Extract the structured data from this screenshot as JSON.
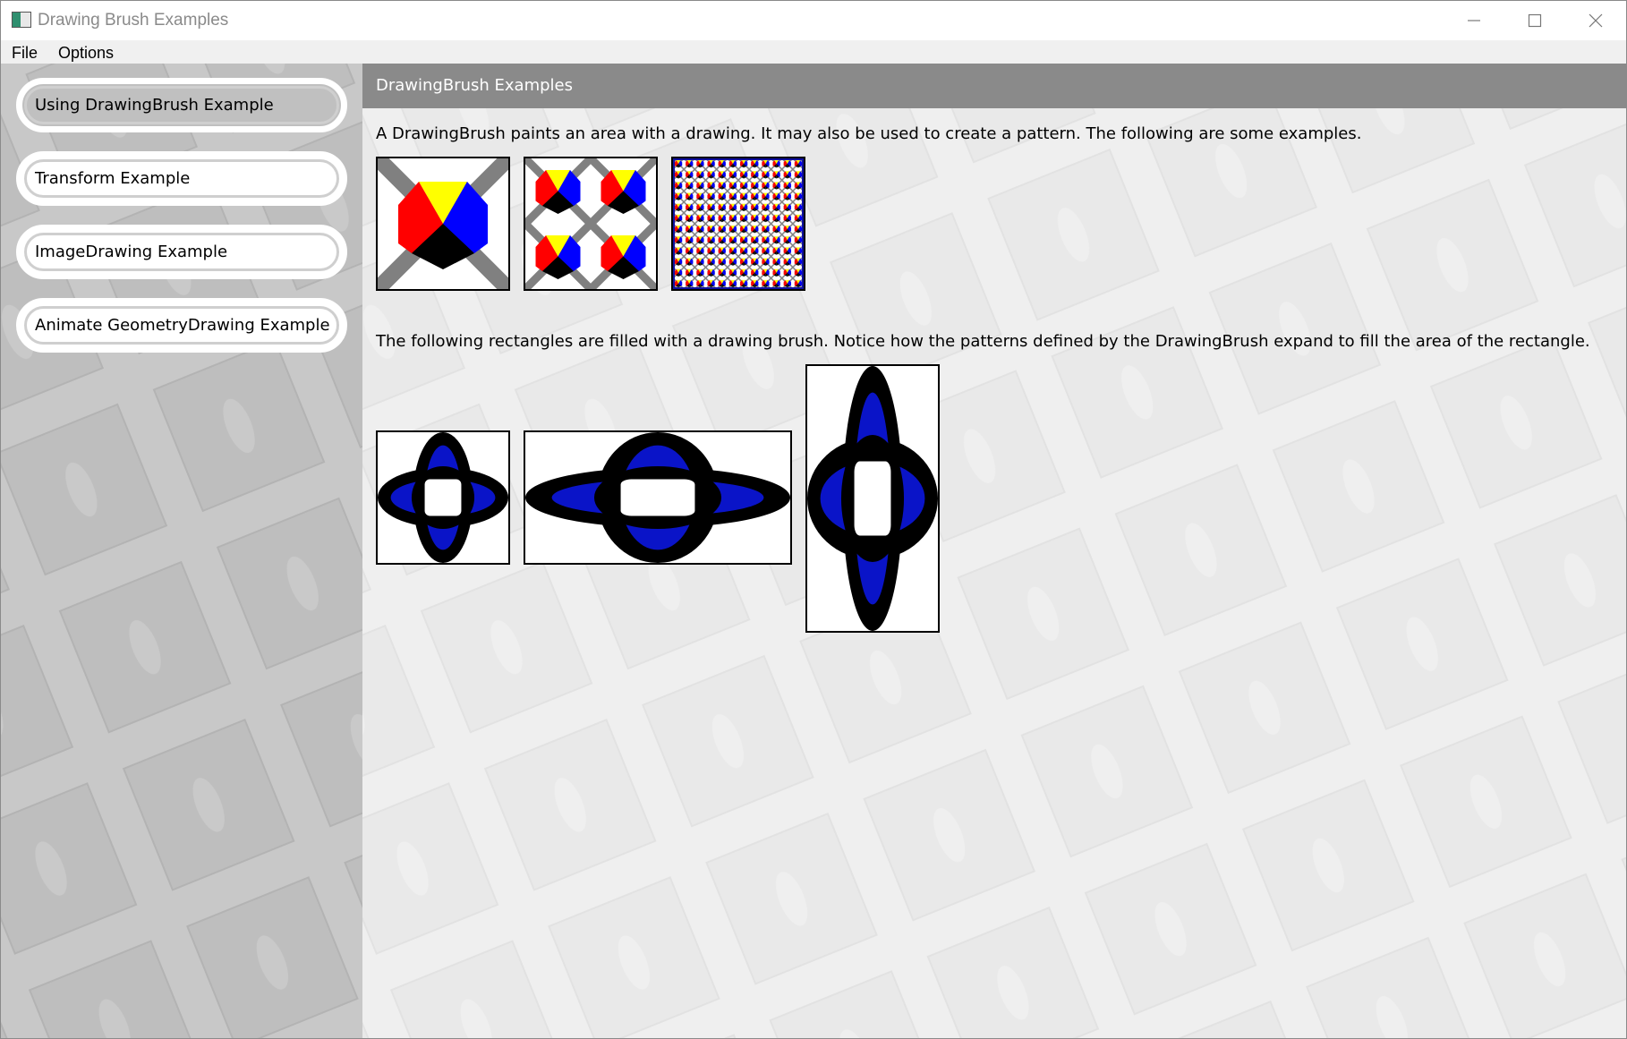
{
  "window": {
    "title": "Drawing Brush Examples",
    "icon": "app-window-icon",
    "controls": [
      "minimize-icon",
      "maximize-icon",
      "close-icon"
    ]
  },
  "menu": {
    "items": [
      "File",
      "Options"
    ]
  },
  "sidebar": {
    "items": [
      {
        "label": "Using DrawingBrush Example",
        "selected": true
      },
      {
        "label": "Transform Example",
        "selected": false
      },
      {
        "label": "ImageDrawing Example",
        "selected": false
      },
      {
        "label": "Animate GeometryDrawing Example",
        "selected": false
      }
    ]
  },
  "main": {
    "header": "DrawingBrush Examples",
    "intro": "A DrawingBrush paints an area with a drawing. It may also be used to create a pattern. The following are some examples.",
    "second_paragraph": "The following rectangles are filled with a drawing brush. Notice how the patterns defined by the DrawingBrush expand to fill the area of the rectangle.",
    "pattern_tiles": [
      {
        "name": "single-drawing",
        "tiles": 1
      },
      {
        "name": "tiled-2x2",
        "tiles": 2
      },
      {
        "name": "tiled-dense",
        "tiles": 12
      }
    ],
    "stretch_rectangles": [
      "square",
      "wide",
      "tall"
    ]
  },
  "colors": {
    "yellow": "#ffff00",
    "red": "#ff0000",
    "blue": "#0000ff",
    "dark_blue": "#0a14c8",
    "black": "#000000",
    "gray_stripe": "#808080",
    "header_band": "#8a8a8a",
    "sidebar_bg": "#c8c8c8",
    "main_bg": "#efefef"
  }
}
